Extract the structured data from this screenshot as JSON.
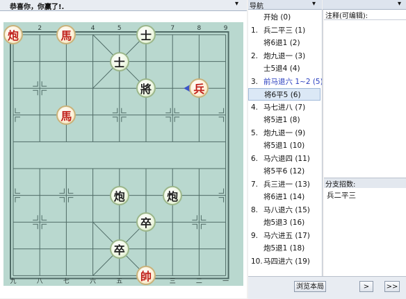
{
  "board_panel": {
    "title": "恭喜你，你赢了!.",
    "pin_icon": "▾"
  },
  "nav_panel": {
    "title": "导航",
    "pin_icon": "▾",
    "moves": [
      {
        "num": "",
        "text": "开始 (0)",
        "selected": false,
        "branch": false
      },
      {
        "num": "1.",
        "text": "兵二平三 (1)",
        "selected": false,
        "branch": false
      },
      {
        "num": "",
        "text": "将6退1 (2)",
        "selected": false,
        "branch": false
      },
      {
        "num": "2.",
        "text": "炮九退一 (3)",
        "selected": false,
        "branch": false
      },
      {
        "num": "",
        "text": "士5退4 (4)",
        "selected": false,
        "branch": false
      },
      {
        "num": "3.",
        "text": "前马退六 1~2 (5)",
        "selected": false,
        "branch": true
      },
      {
        "num": "",
        "text": "将6平5 (6)",
        "selected": true,
        "branch": false
      },
      {
        "num": "4.",
        "text": "马七进八 (7)",
        "selected": false,
        "branch": false
      },
      {
        "num": "",
        "text": "将5进1 (8)",
        "selected": false,
        "branch": false
      },
      {
        "num": "5.",
        "text": "炮九退一 (9)",
        "selected": false,
        "branch": false
      },
      {
        "num": "",
        "text": "将5退1 (10)",
        "selected": false,
        "branch": false
      },
      {
        "num": "6.",
        "text": "马六退四 (11)",
        "selected": false,
        "branch": false
      },
      {
        "num": "",
        "text": "将5平6 (12)",
        "selected": false,
        "branch": false
      },
      {
        "num": "7.",
        "text": "兵三进一 (13)",
        "selected": false,
        "branch": false
      },
      {
        "num": "",
        "text": "将6进1 (14)",
        "selected": false,
        "branch": false
      },
      {
        "num": "8.",
        "text": "马八退六 (15)",
        "selected": false,
        "branch": false
      },
      {
        "num": "",
        "text": "炮5退3 (16)",
        "selected": false,
        "branch": false
      },
      {
        "num": "9.",
        "text": "马六进五 (17)",
        "selected": false,
        "branch": false
      },
      {
        "num": "",
        "text": "炮5退1 (18)",
        "selected": false,
        "branch": false
      },
      {
        "num": "10.",
        "text": "马四进六 (19)",
        "selected": false,
        "branch": false
      }
    ]
  },
  "comment_panel": {
    "label": "注释(可编辑):",
    "pin_icon": "▾"
  },
  "branch_panel": {
    "label": "分支招数:",
    "items": [
      "兵二平三"
    ]
  },
  "bottom_bar": {
    "browse_button": "浏览本局",
    "next_button": ">",
    "last_button": ">>"
  },
  "board": {
    "top_files": [
      "1",
      "2",
      "3",
      "4",
      "5",
      "6",
      "7",
      "8",
      "9"
    ],
    "bottom_files": [
      "九",
      "八",
      "七",
      "六",
      "五",
      "四",
      "三",
      "二",
      "一"
    ],
    "colors": {
      "background": "#b9d8cf",
      "red": "#c0201a",
      "black": "#1f1f1f",
      "arrow": "#3c56c8"
    },
    "pieces": [
      {
        "side": "red",
        "char": "炮",
        "file": 0,
        "rank": 0
      },
      {
        "side": "red",
        "char": "馬",
        "file": 2,
        "rank": 0
      },
      {
        "side": "black",
        "char": "士",
        "file": 5,
        "rank": 0
      },
      {
        "side": "black",
        "char": "士",
        "file": 4,
        "rank": 1
      },
      {
        "side": "black",
        "char": "將",
        "file": 5,
        "rank": 2
      },
      {
        "side": "red",
        "char": "兵",
        "file": 7,
        "rank": 2
      },
      {
        "side": "red",
        "char": "馬",
        "file": 2,
        "rank": 3
      },
      {
        "side": "black",
        "char": "炮",
        "file": 4,
        "rank": 6
      },
      {
        "side": "black",
        "char": "炮",
        "file": 6,
        "rank": 6
      },
      {
        "side": "black",
        "char": "卒",
        "file": 5,
        "rank": 7
      },
      {
        "side": "black",
        "char": "卒",
        "file": 4,
        "rank": 8
      },
      {
        "side": "red",
        "char": "帥",
        "file": 5,
        "rank": 9
      }
    ],
    "last_move": {
      "from_file": 7,
      "from_rank": 2,
      "to_file": 6,
      "to_rank": 2
    }
  }
}
